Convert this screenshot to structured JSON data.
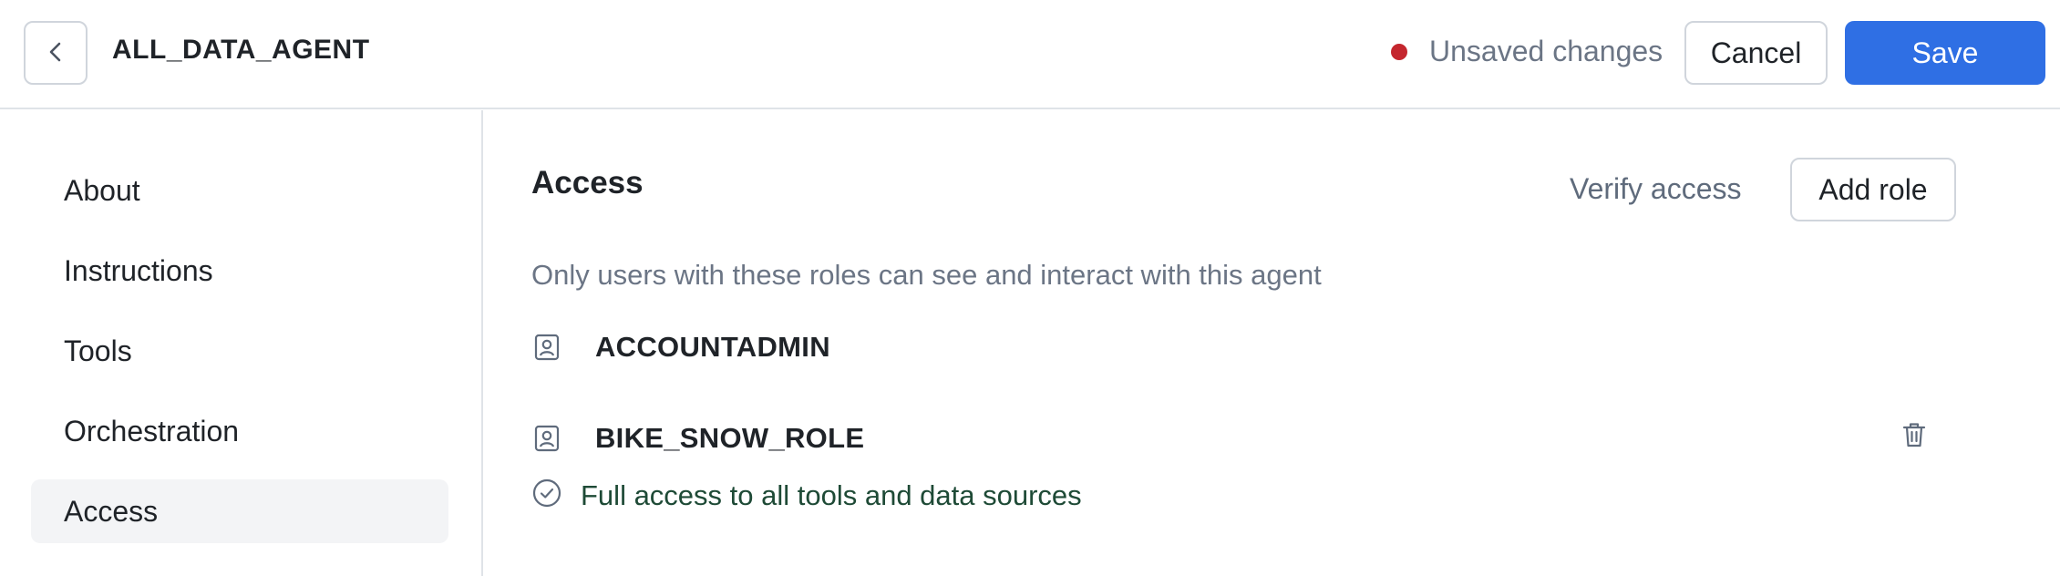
{
  "header": {
    "back_icon": "chevron-left-icon",
    "title": "ALL_DATA_AGENT",
    "status_color": "#c4262e",
    "status_text": "Unsaved changes",
    "cancel_label": "Cancel",
    "save_label": "Save",
    "save_color": "#2f6fe4"
  },
  "sidebar": {
    "items": [
      {
        "label": "About",
        "active": false
      },
      {
        "label": "Instructions",
        "active": false
      },
      {
        "label": "Tools",
        "active": false
      },
      {
        "label": "Orchestration",
        "active": false
      },
      {
        "label": "Access",
        "active": true
      }
    ]
  },
  "access": {
    "title": "Access",
    "verify_label": "Verify access",
    "add_role_label": "Add role",
    "description": "Only users with these roles can see and interact with this agent",
    "roles": [
      {
        "name": "ACCOUNTADMIN",
        "icon": "role-badge-icon"
      },
      {
        "name": "BIKE_SNOW_ROLE",
        "icon": "role-badge-icon",
        "delete_icon": "trash-icon"
      }
    ],
    "access_note": "Full access to all tools and data sources",
    "access_note_color": "#1e4a36"
  }
}
